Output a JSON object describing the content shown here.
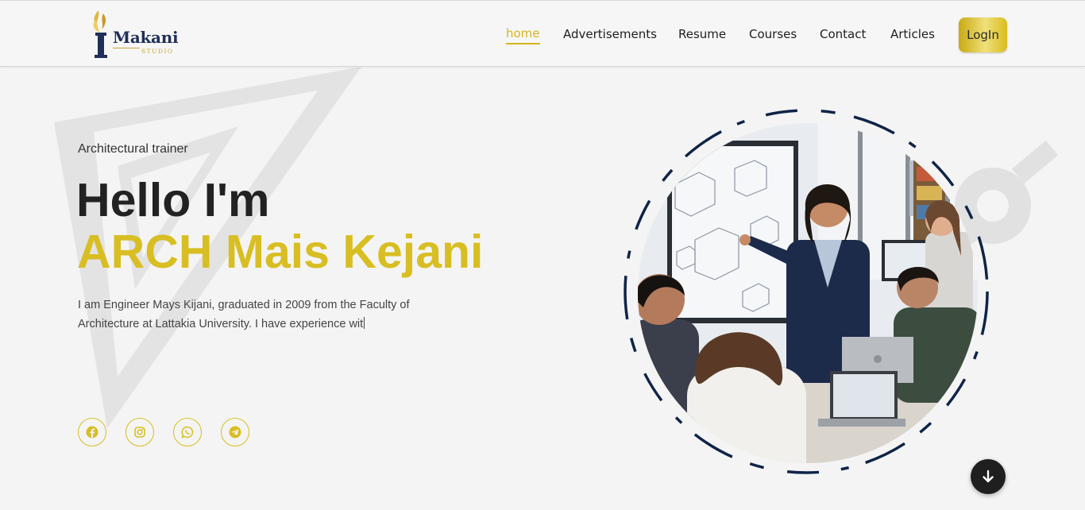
{
  "brand": {
    "name": "Makani",
    "sub": "STUDIO",
    "colors": {
      "navy": "#1f2f57",
      "gold": "#c8a42c"
    }
  },
  "nav": {
    "items": [
      {
        "label": "home",
        "active": true
      },
      {
        "label": "Advertisements",
        "active": false
      },
      {
        "label": "Resume",
        "active": false
      },
      {
        "label": "Courses",
        "active": false
      },
      {
        "label": "Contact",
        "active": false
      },
      {
        "label": "Articles",
        "active": false
      }
    ],
    "login_label": "LogIn"
  },
  "hero": {
    "subtitle": "Architectural trainer",
    "greeting": "Hello I'm",
    "name": "ARCH Mais Kejani",
    "description": "I am Engineer Mays Kijani, graduated in 2009 from the Faculty of Architecture at Lattakia University. I have experience wit",
    "accent_color": "#d8be22"
  },
  "social": [
    {
      "icon": "facebook-icon"
    },
    {
      "icon": "instagram-icon"
    },
    {
      "icon": "whatsapp-icon"
    },
    {
      "icon": "telegram-icon"
    }
  ],
  "photo": {
    "subject": "trainer presenting building models on a screen to students at laptops",
    "ring_color": "#0f2447"
  },
  "scroll_button": {
    "icon": "arrow-down-icon"
  }
}
